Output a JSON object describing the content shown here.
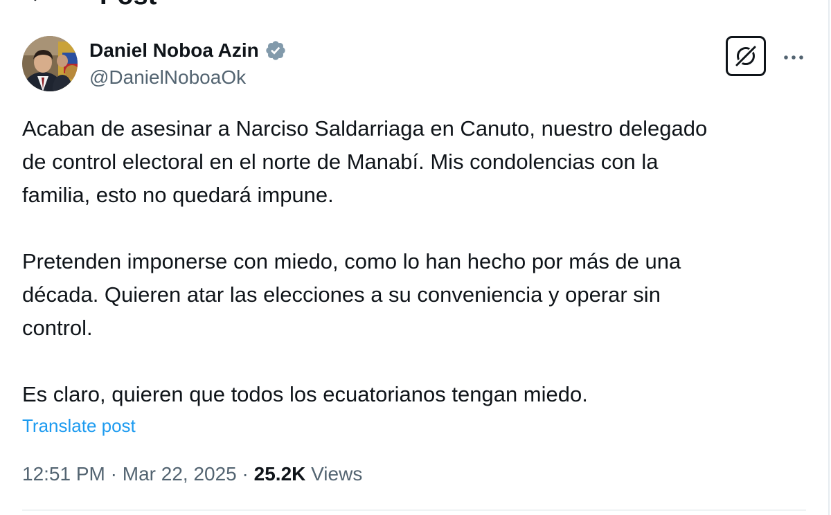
{
  "header": {
    "title": "Post",
    "back_icon": "back-arrow-icon"
  },
  "author": {
    "name": "Daniel Noboa Azin",
    "handle": "@DanielNoboaOk",
    "verified_badge_icon": "verified-badge-icon",
    "verified_color": "#829aab"
  },
  "actions": {
    "grok_icon": "grok-icon",
    "more_icon": "more-dots-icon"
  },
  "post": {
    "paragraphs": [
      {
        "lines": [
          "Acaban de asesinar a Narciso Saldarriaga en Canuto, nuestro delegado",
          "de control electoral en el norte de Manabí. Mis condolencias con la",
          "familia, esto no quedará impune."
        ]
      },
      {
        "lines": [
          "Pretenden imponerse con miedo, como lo han hecho por más de una",
          "década. Quieren atar las elecciones a su conveniencia y operar sin",
          "control."
        ]
      },
      {
        "lines": [
          "Es claro, quieren que todos los ecuatorianos tengan miedo."
        ]
      }
    ],
    "translate_label": "Translate post"
  },
  "meta": {
    "time": "12:51 PM",
    "separator": "·",
    "date": "Mar 22, 2025",
    "views_count": "25.2K",
    "views_label": "Views"
  },
  "colors": {
    "text_primary": "#0f1419",
    "text_secondary": "#536471",
    "link": "#1d9bf0",
    "divider": "#eff3f4"
  }
}
